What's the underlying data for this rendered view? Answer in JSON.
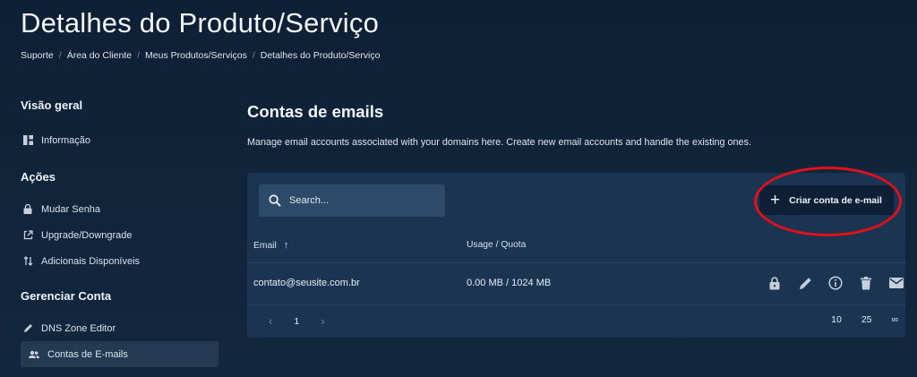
{
  "page": {
    "title": "Detalhes do Produto/Serviço",
    "breadcrumb": [
      "Suporte",
      "Área do Cliente",
      "Meus Produtos/Serviços",
      "Detalhes do Produto/Serviço"
    ]
  },
  "sidebar": {
    "sections": [
      {
        "heading": "Visão geral",
        "items": [
          {
            "label": "Informação",
            "icon": "dashboard-icon"
          }
        ]
      },
      {
        "heading": "Ações",
        "items": [
          {
            "label": "Mudar Senha",
            "icon": "lock-icon"
          },
          {
            "label": "Upgrade/Downgrade",
            "icon": "external-link-icon"
          },
          {
            "label": "Adicionais Disponíveis",
            "icon": "swap-vertical-icon"
          }
        ]
      },
      {
        "heading": "Gerenciar Conta",
        "items": [
          {
            "label": "DNS Zone Editor",
            "icon": "pencil-icon"
          },
          {
            "label": "Contas de E-mails",
            "icon": "users-icon",
            "active": true
          }
        ]
      }
    ]
  },
  "main": {
    "title": "Contas de emails",
    "description": "Manage email accounts associated with your domains here. Create new email accounts and handle the existing ones.",
    "search_placeholder": "Search...",
    "create_button": "Criar conta de e-mail",
    "table": {
      "columns": [
        "Email",
        "Usage / Quota"
      ],
      "rows": [
        {
          "email": "contato@seusite.com.br",
          "usage": "0.00 MB / 1024 MB",
          "actions": [
            "lock-icon",
            "pencil-icon",
            "info-icon",
            "trash-icon",
            "mail-icon"
          ]
        }
      ]
    },
    "pagination": {
      "current": "1",
      "page_sizes": [
        "10",
        "25",
        "∞"
      ]
    }
  },
  "colors": {
    "background": "#12283f",
    "panel": "#1b3452",
    "highlight": "#e0101c"
  }
}
